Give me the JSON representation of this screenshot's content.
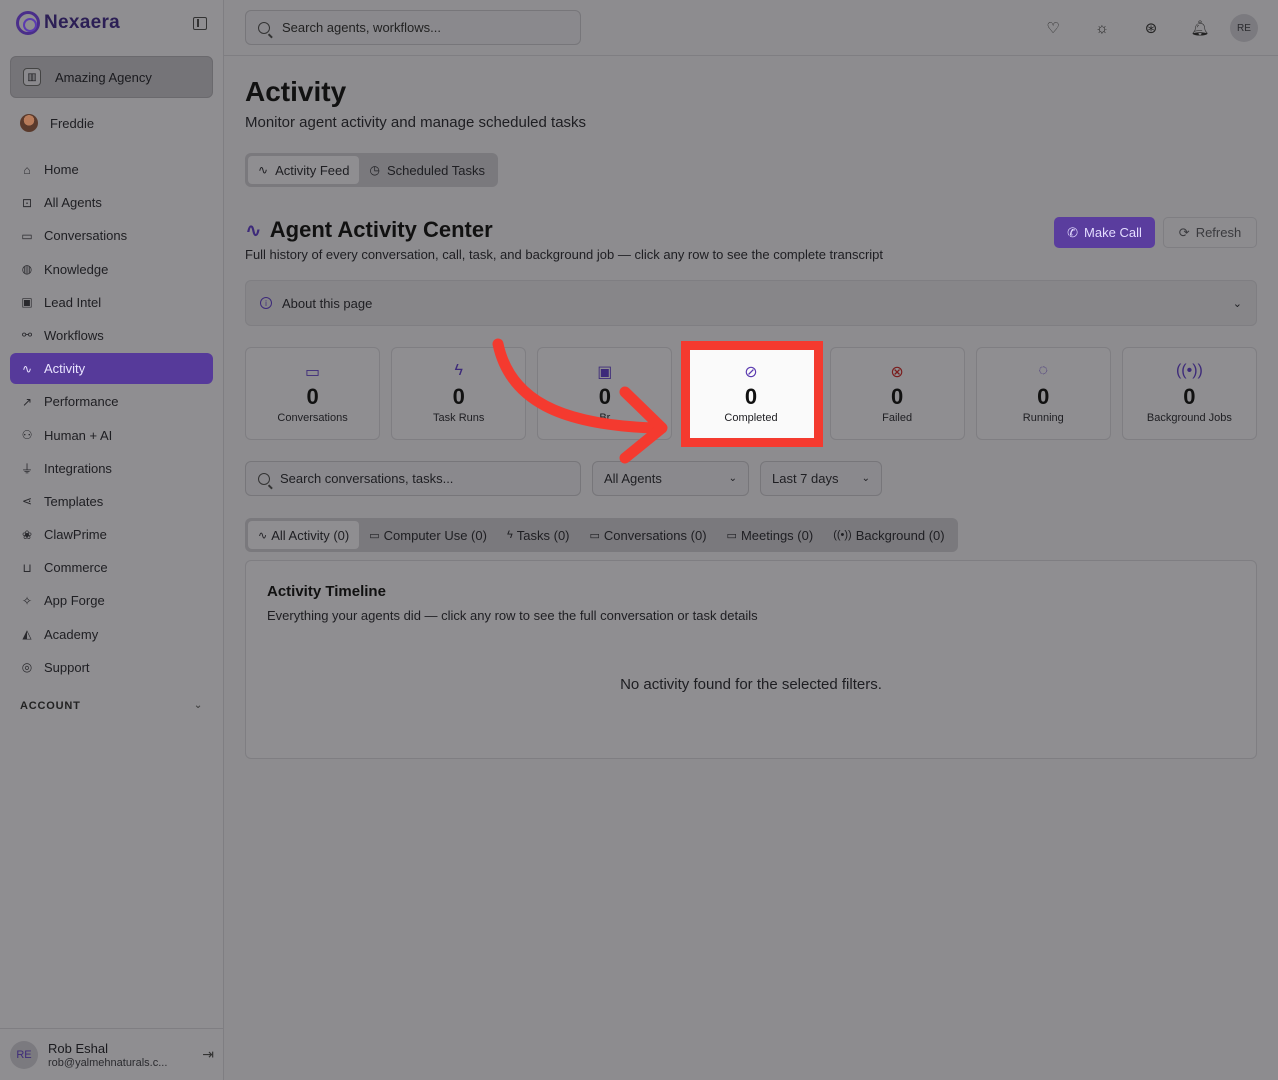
{
  "brand": {
    "name": "Nexaera"
  },
  "agency": {
    "name": "Amazing Agency"
  },
  "user": {
    "name": "Freddie"
  },
  "nav": [
    {
      "label": "Home",
      "icon": "home-icon"
    },
    {
      "label": "All Agents",
      "icon": "bot-icon"
    },
    {
      "label": "Conversations",
      "icon": "chat-icon"
    },
    {
      "label": "Knowledge",
      "icon": "globe-icon"
    },
    {
      "label": "Lead Intel",
      "icon": "contact-icon"
    },
    {
      "label": "Workflows",
      "icon": "workflow-icon"
    },
    {
      "label": "Activity",
      "icon": "activity-icon",
      "active": true
    },
    {
      "label": "Performance",
      "icon": "trending-icon"
    },
    {
      "label": "Human + AI",
      "icon": "people-icon"
    },
    {
      "label": "Integrations",
      "icon": "plug-icon"
    },
    {
      "label": "Templates",
      "icon": "share-icon"
    },
    {
      "label": "ClawPrime",
      "icon": "paw-icon"
    },
    {
      "label": "Commerce",
      "icon": "cart-icon"
    },
    {
      "label": "App Forge",
      "icon": "sparkle-icon"
    },
    {
      "label": "Academy",
      "icon": "graduation-icon"
    },
    {
      "label": "Support",
      "icon": "lifebuoy-icon"
    }
  ],
  "section": {
    "account": "ACCOUNT"
  },
  "account": {
    "initials": "RE",
    "name": "Rob Eshal",
    "email": "rob@yalmehnaturals.c..."
  },
  "topbar": {
    "search_placeholder": "Search agents, workflows...",
    "avatar_initials": "RE"
  },
  "page": {
    "title": "Activity",
    "subtitle": "Monitor agent activity and manage scheduled tasks"
  },
  "tabs": [
    {
      "label": "Activity Feed"
    },
    {
      "label": "Scheduled Tasks"
    }
  ],
  "center": {
    "title": "Agent Activity Center",
    "subtitle": "Full history of every conversation, call, task, and background job — click any row to see the complete transcript",
    "make_call": "Make Call",
    "refresh": "Refresh"
  },
  "about": {
    "label": "About this page"
  },
  "stats": [
    {
      "value": "0",
      "label": "Conversations"
    },
    {
      "value": "0",
      "label": "Task Runs"
    },
    {
      "value": "0",
      "label": "Br"
    },
    {
      "value": "0",
      "label": "Completed"
    },
    {
      "value": "0",
      "label": "Failed"
    },
    {
      "value": "0",
      "label": "Running"
    },
    {
      "value": "0",
      "label": "Background Jobs"
    }
  ],
  "filters": {
    "search_placeholder": "Search conversations, tasks...",
    "agents": "All Agents",
    "range": "Last 7 days"
  },
  "subtabs": [
    {
      "label": "All Activity (0)"
    },
    {
      "label": "Computer Use (0)"
    },
    {
      "label": "Tasks (0)"
    },
    {
      "label": "Conversations (0)"
    },
    {
      "label": "Meetings (0)"
    },
    {
      "label": "Background (0)"
    }
  ],
  "timeline": {
    "title": "Activity Timeline",
    "subtitle": "Everything your agents did — click any row to see the full conversation or task details",
    "empty": "No activity found for the selected filters."
  },
  "colors": {
    "accent": "#5a3d9e",
    "highlight": "#f43a2f",
    "danger": "#7a1c1c"
  }
}
